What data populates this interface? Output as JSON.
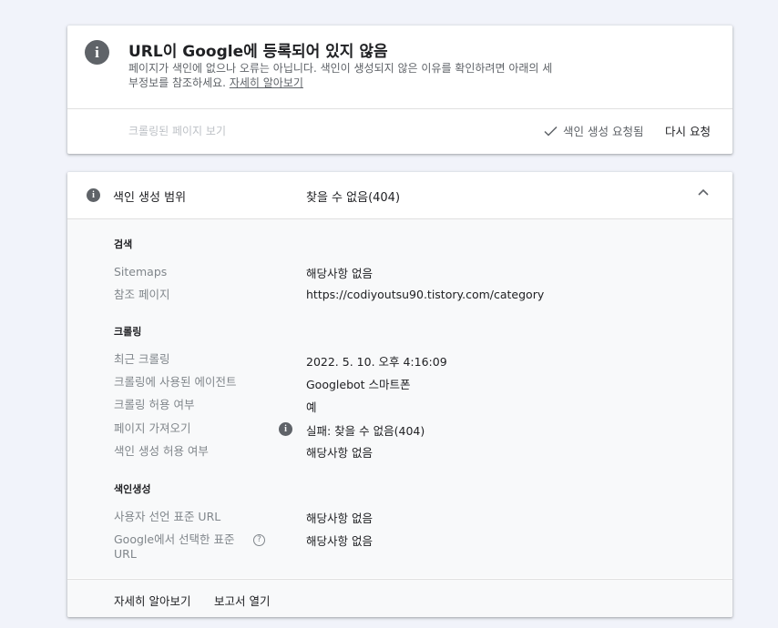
{
  "status": {
    "title": "URL이 Google에 등록되어 있지 않음",
    "desc_prefix": "페이지가 색인에 없으나 오류는 아닙니다. 색인이 생성되지 않은 이유를 확인하려면 아래의 세부정보를 참조하세요. ",
    "learn_more_link": "자세히 알아보기",
    "crawled_page_label": "크롤링된 페이지 보기",
    "index_requested_label": "색인 생성 요청됨",
    "rerequest_label": "다시 요청"
  },
  "coverage": {
    "header_label": "색인 생성 범위",
    "header_value": "찾을 수 없음(404)",
    "sections": {
      "search": {
        "title": "검색",
        "sitemaps_label": "Sitemaps",
        "sitemaps_value": "해당사항 없음",
        "referring_label": "참조 페이지",
        "referring_value": "https://codiyoutsu90.tistory.com/category"
      },
      "crawl": {
        "title": "크롤링",
        "last_crawl_label": "최근 크롤링",
        "last_crawl_value": "2022. 5. 10. 오후 4:16:09",
        "agent_label": "크롤링에 사용된 에이전트",
        "agent_value": "Googlebot 스마트폰",
        "allowed_label": "크롤링 허용 여부",
        "allowed_value": "예",
        "fetch_label": "페이지 가져오기",
        "fetch_value": "실패: 찾을 수 없음(404)",
        "indexing_allowed_label": "색인 생성 허용 여부",
        "indexing_allowed_value": "해당사항 없음"
      },
      "indexing": {
        "title": "색인생성",
        "user_canonical_label": "사용자 선언 표준 URL",
        "user_canonical_value": "해당사항 없음",
        "google_canonical_label_line1": "Google에서 선택한 표준",
        "google_canonical_label_line2": "URL",
        "google_canonical_value": "해당사항 없음"
      }
    },
    "footer": {
      "learn_more": "자세히 알아보기",
      "open_report": "보고서 열기"
    }
  },
  "icons": {
    "info": "info-icon",
    "check": "check-icon",
    "collapse": "chevron-up-icon",
    "help": "help-icon"
  },
  "colors": {
    "background": "#f1f3fa",
    "icon_grey": "#5f6368",
    "label_grey": "#80868b"
  }
}
